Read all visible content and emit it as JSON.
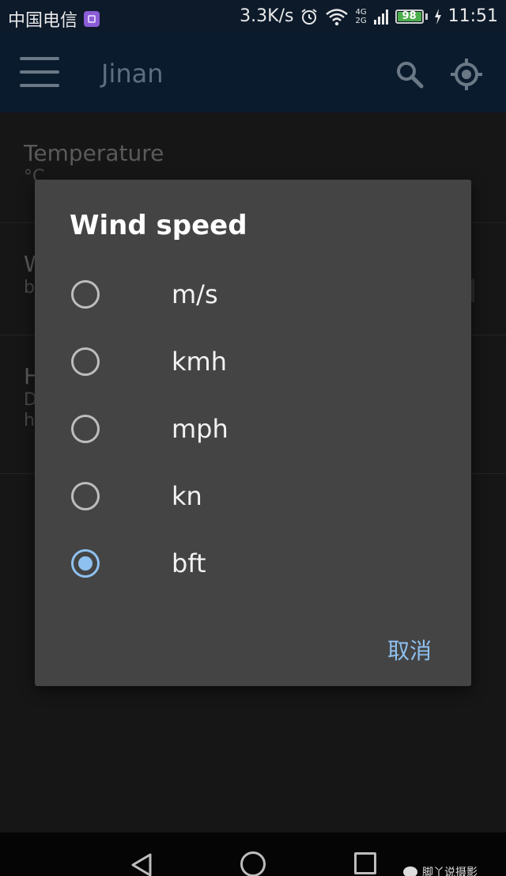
{
  "status_bar": {
    "carrier": "中国电信",
    "net_speed": "3.3K/s",
    "network_labels": [
      "4G",
      "2G"
    ],
    "battery_level": "98",
    "time": "11:51"
  },
  "app_bar": {
    "title": "Jinan"
  },
  "settings": [
    {
      "title": "Temperature",
      "summary": "°C"
    },
    {
      "title": "W",
      "summary": "b"
    },
    {
      "title": "H",
      "summary": "D",
      "summary2": "h"
    }
  ],
  "dialog": {
    "title": "Wind speed",
    "options": [
      "m/s",
      "kmh",
      "mph",
      "kn",
      "bft"
    ],
    "selected_index": 4,
    "cancel_label": "取消"
  },
  "watermark": {
    "text": "脚丫说摄影"
  },
  "colors": {
    "accent": "#8fc1f0",
    "dialog_bg": "#444444",
    "app_bar_bg": "#0b1b2e"
  }
}
